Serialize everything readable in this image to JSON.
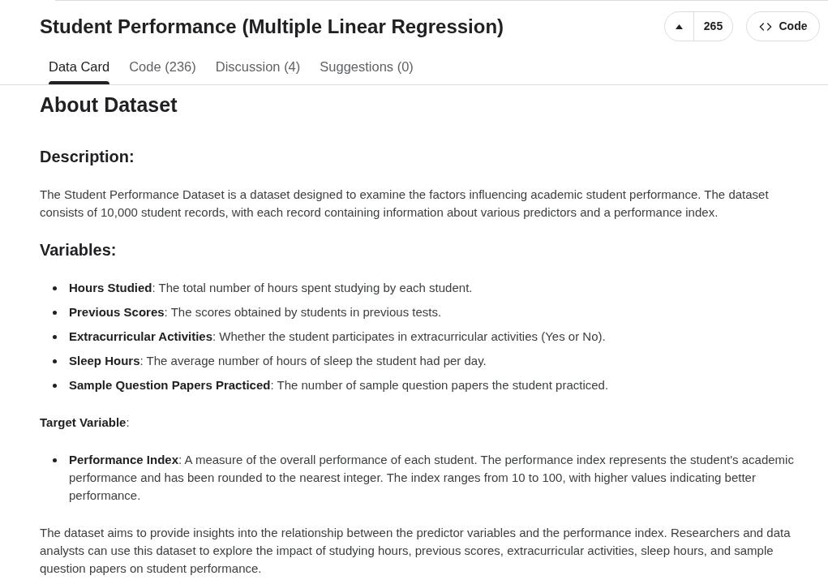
{
  "header": {
    "title": "Student Performance (Multiple Linear Regression)",
    "vote_count": "265",
    "code_button": "Code"
  },
  "tabs": [
    {
      "label": "Data Card",
      "selected": true
    },
    {
      "label": "Code (236)",
      "selected": false
    },
    {
      "label": "Discussion (4)",
      "selected": false
    },
    {
      "label": "Suggestions (0)",
      "selected": false
    }
  ],
  "body": [
    {
      "kind": "h1",
      "text": "About Dataset"
    },
    {
      "kind": "h2",
      "text": "Description:"
    },
    {
      "kind": "paragraph",
      "text": "The Student Performance Dataset is a dataset designed to examine the factors influencing academic student performance. The dataset consists of 10,000 student records, with each record containing information about various predictors and a performance index."
    },
    {
      "kind": "h2",
      "text": "Variables:"
    },
    {
      "kind": "list",
      "items": [
        "**Hours Studied**: The total number of hours spent studying by each student.",
        "**Previous Scores**: The scores obtained by students in previous tests.",
        "**Extracurricular Activities**: Whether the student participates in extracurricular activities (Yes or No).",
        "**Sleep Hours**: The average number of hours of sleep the student had per day.",
        "**Sample Question Papers Practiced**: The number of sample question papers the student practiced."
      ]
    },
    {
      "kind": "paragraph",
      "text": "**Target Variable**:"
    },
    {
      "kind": "list",
      "items": [
        "**Performance Index**: A measure of the overall performance of each student. The performance index represents the student's academic performance and has been rounded to the nearest integer. The index ranges from 10 to 100, with higher values indicating better performance."
      ]
    },
    {
      "kind": "paragraph",
      "text": "The dataset aims to provide insights into the relationship between the predictor variables and the performance index. Researchers and data analysts can use this dataset to explore the impact of studying hours, previous scores, extracurricular activities, sleep hours, and sample question papers on student performance."
    }
  ]
}
